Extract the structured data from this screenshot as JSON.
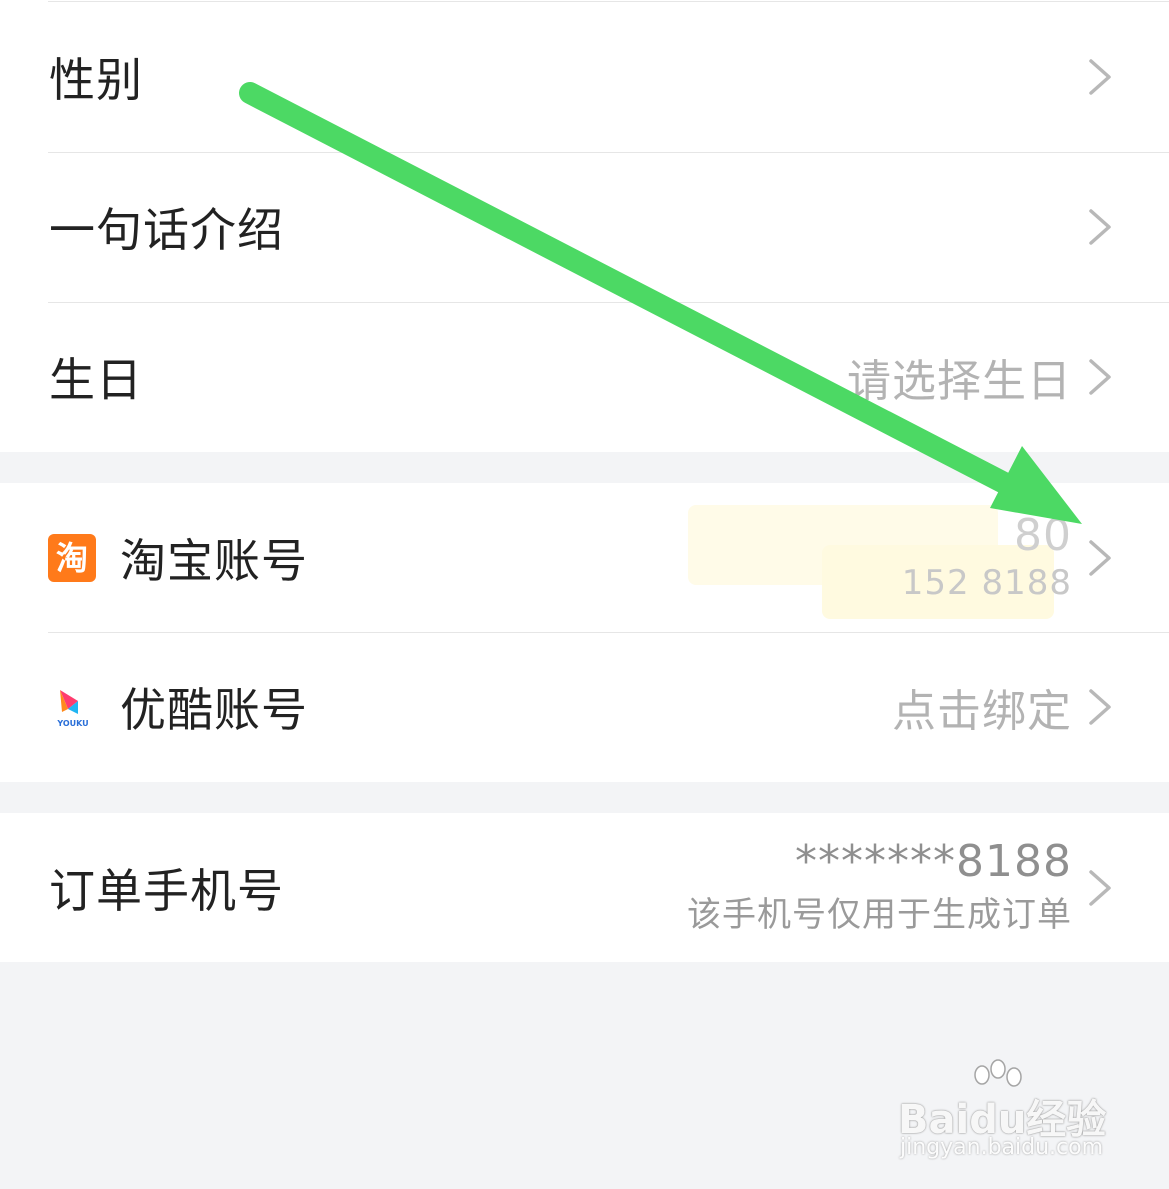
{
  "section1": {
    "rows": [
      {
        "label": "性别",
        "value": ""
      },
      {
        "label": "一句话介绍",
        "value": ""
      },
      {
        "label": "生日",
        "value": "请选择生日"
      }
    ]
  },
  "section2": {
    "taobao": {
      "label": "淘宝账号",
      "icon": "taobao-icon",
      "icon_char": "淘",
      "value_partial_top": "80",
      "value_partial_bottom": "152 8188"
    },
    "youku": {
      "label": "优酷账号",
      "icon": "youku-icon",
      "icon_text": "YOUKU",
      "value": "点击绑定"
    }
  },
  "section3": {
    "order_phone": {
      "label": "订单手机号",
      "masked": "*******8188",
      "note": "该手机号仅用于生成订单"
    }
  },
  "watermark": {
    "brand": "Baidu经验",
    "url": "jingyan.baidu.com"
  },
  "colors": {
    "page_bg": "#f3f4f6",
    "card_bg": "#ffffff",
    "label": "#222222",
    "value": "#b3b3b3",
    "arrow": "#4cd964",
    "taobao": "#ff7a1a"
  },
  "icons": {
    "chevron": "chevron-right-icon",
    "arrow": "green-arrow-annotation"
  }
}
